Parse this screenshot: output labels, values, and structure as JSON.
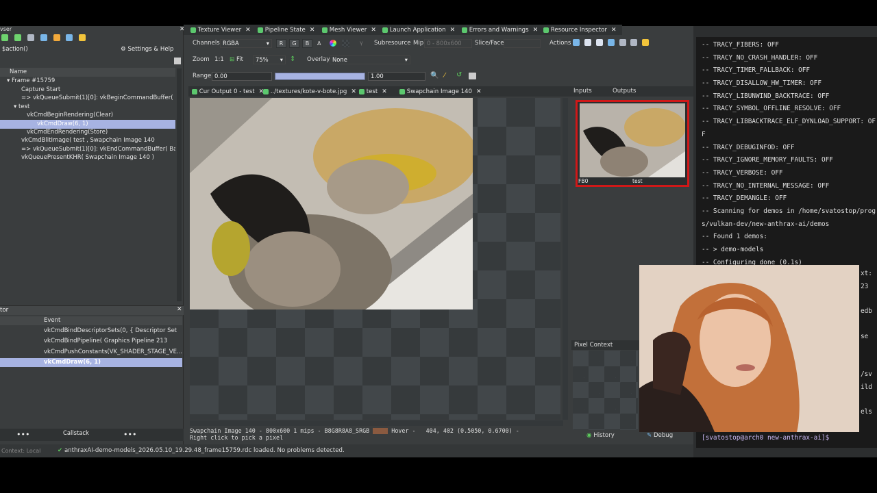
{
  "tabs": [
    {
      "label": "Texture Viewer"
    },
    {
      "label": "Pipeline State"
    },
    {
      "label": "Mesh Viewer"
    },
    {
      "label": "Launch Application"
    },
    {
      "label": "Errors and Warnings"
    },
    {
      "label": "Resource Inspector"
    }
  ],
  "left": {
    "title_fragment": "vser",
    "filter_value": "$action()",
    "settings_label": "Settings & Help",
    "col_name": "Name",
    "tree": [
      "Frame #15759",
      "Capture Start",
      "=> vkQueueSubmit(1)[0]: vkBeginCommandBuffer( Ba",
      "test",
      "vkCmdBeginRendering(Clear)",
      "vkCmdDraw(6, 1)",
      "vkCmdEndRendering(Store)",
      "vkCmdBlitImage( test , Swapchain Image 140",
      "=> vkQueueSubmit(1)[0]: vkEndCommandBuffer( Bak",
      "vkQueuePresentKHR( Swapchain Image 140 )"
    ],
    "inspector_title": "tor",
    "col_event": "Event",
    "api_events": [
      "vkCmdBindDescriptorSets(0, { Descriptor Set",
      "vkCmdBindPipeline( Graphics Pipeline 213",
      "vkCmdPushConstants(VK_SHADER_STAGE_VE...",
      "vkCmdDraw(6, 1)"
    ],
    "callstack_label": "Callstack"
  },
  "toolbar": {
    "channels_label": "Channels",
    "channels_value": "RGBA",
    "r": "R",
    "g": "G",
    "b": "B",
    "a": "A",
    "subresource_label": "Subresource",
    "mip_label": "Mip",
    "mip_value": "0 - 800x600",
    "slice_label": "Slice/Face",
    "actions_label": "Actions",
    "zoom_label": "Zoom",
    "zoom_11": "1:1",
    "fit_label": "Fit",
    "zoom_value": "75%",
    "overlay_label": "Overlay",
    "overlay_value": "None",
    "range_label": "Range",
    "range_min": "0.00",
    "range_max": "1.00"
  },
  "subtabs": [
    {
      "label": "Cur Output 0 - test"
    },
    {
      "label": "../textures/kote-v-bote.jpg"
    },
    {
      "label": "test"
    },
    {
      "label": "Swapchain Image 140"
    }
  ],
  "status": {
    "image_info": "Swapchain Image 140 - 800x600 1 mips - B8G8R8A8_SRGB",
    "hover_label": "Hover -",
    "hover_value": "404,  402 (0.5050, 0.6700)  -",
    "hint": "Right click to pick a pixel"
  },
  "thumbs": {
    "inputs_label": "Inputs",
    "outputs_label": "Outputs",
    "fb_label": "FB0",
    "name": "test"
  },
  "pixel_context_label": "Pixel Context",
  "history_label": "History",
  "debug_label": "Debug",
  "bottom": {
    "context_label": "Context: Local",
    "message": "anthraxAI-demo-models_2026.05.10_19.29.48_frame15759.rdc loaded. No problems detected."
  },
  "terminal": {
    "lines": [
      "-- TRACY_FIBERS: OFF",
      "-- TRACY_NO_CRASH_HANDLER: OFF",
      "-- TRACY_TIMER_FALLBACK: OFF",
      "-- TRACY_DISALLOW_HW_TIMER: OFF",
      "-- TRACY_LIBUNWIND_BACKTRACE: OFF",
      "-- TRACY_SYMBOL_OFFLINE_RESOLVE: OFF",
      "-- TRACY_LIBBACKTRACE_ELF_DYNLOAD_SUPPORT: OF",
      "F",
      "-- TRACY_DEBUGINFOD: OFF",
      "-- TRACY_IGNORE_MEMORY_FAULTS: OFF",
      "-- TRACY_VERBOSE: OFF",
      "-- TRACY_NO_INTERNAL_MESSAGE: OFF",
      "-- TRACY_DEMANGLE: OFF",
      "-- Scanning for demos in /home/svatostop/prog",
      "s/vulkan-dev/new-anthrax-ai/demos",
      "-- Found 1 demos:",
      "-- > demo-models",
      "-- Configuring done (0.1s)"
    ],
    "side_fragments": [
      "xt:",
      "23",
      "edb",
      "se",
      "/sv",
      "ild",
      "els"
    ],
    "prompt": "[svatostop@arch0 new-anthrax-ai]$"
  },
  "colors": {
    "selection": "#a7b3e2",
    "output_border": "#d01818",
    "terminal_prompt": "#c9b8f2"
  }
}
